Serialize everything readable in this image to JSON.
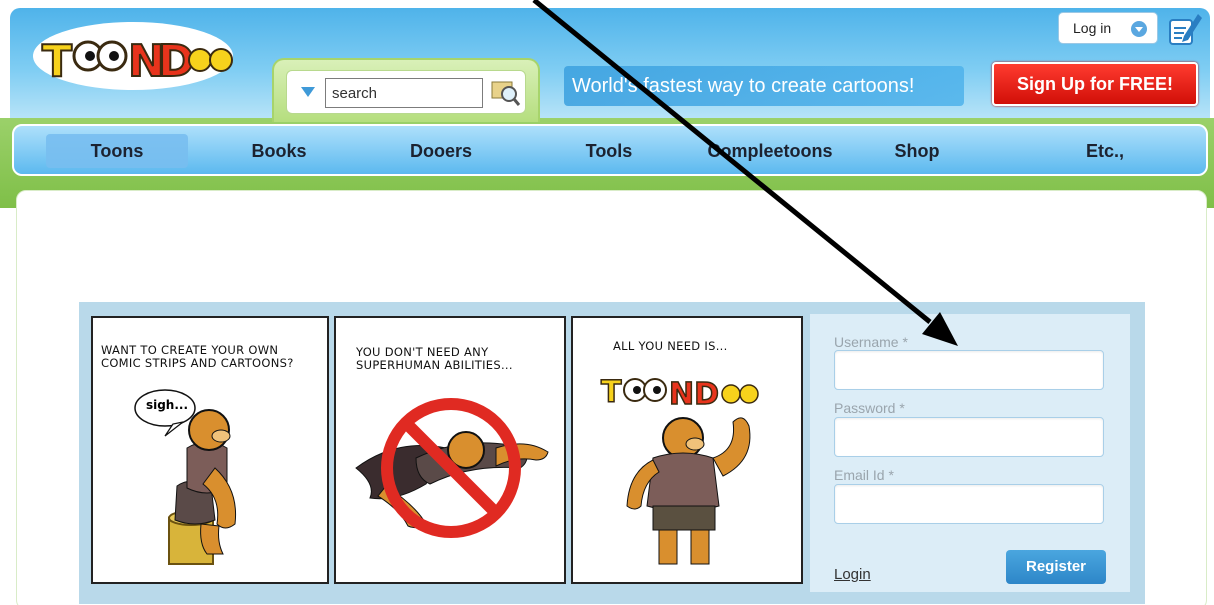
{
  "header": {
    "logo_text": "TOONDOO",
    "search": {
      "placeholder": "search",
      "value": "search"
    },
    "tagline": "World's fastest way to create cartoons!",
    "signup_label": "Sign Up for FREE!",
    "login_label": "Log in"
  },
  "nav": {
    "items": [
      {
        "label": "Toons"
      },
      {
        "label": "Books"
      },
      {
        "label": "Dooers"
      },
      {
        "label": "Tools"
      },
      {
        "label": "Compleetoons"
      },
      {
        "label": "Shop"
      },
      {
        "label": "Etc.,"
      }
    ]
  },
  "comic": {
    "panel1": {
      "line1": "WANT TO CREATE YOUR OWN",
      "line2": "COMIC STRIPS AND CARTOONS?",
      "bubble": "sigh..."
    },
    "panel2": {
      "line1": "YOU DON'T NEED ANY",
      "line2": "SUPERHUMAN ABILITIES..."
    },
    "panel3": {
      "line1": "ALL YOU NEED IS..."
    }
  },
  "form": {
    "username_label": "Username",
    "password_label": "Password",
    "email_label": "Email Id",
    "required_mark": "*",
    "login_link": "Login",
    "register_label": "Register"
  },
  "colors": {
    "header_blue": "#4fb3ea",
    "signup_red": "#e0140c",
    "nav_blue": "#5cb9ef",
    "green_band": "#8ccb55",
    "register_blue": "#2d86c8"
  }
}
